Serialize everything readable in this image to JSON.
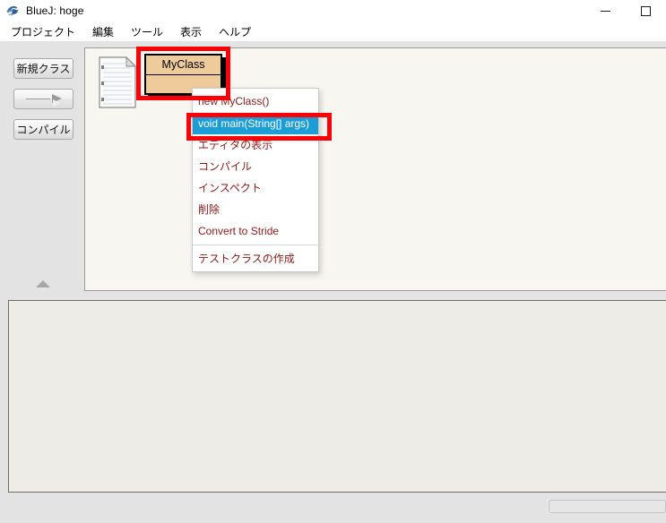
{
  "window": {
    "title": "BlueJ:  hoge",
    "app_icon": "bluej-bird-icon",
    "controls": [
      {
        "name": "minimize-button",
        "glyph": "minimize-icon"
      },
      {
        "name": "maximize-button",
        "glyph": "maximize-icon"
      }
    ]
  },
  "menubar": {
    "items": [
      {
        "label": "プロジェクト",
        "name": "menu-project"
      },
      {
        "label": "編集",
        "name": "menu-edit"
      },
      {
        "label": "ツール",
        "name": "menu-tools"
      },
      {
        "label": "表示",
        "name": "menu-view"
      },
      {
        "label": "ヘルプ",
        "name": "menu-help"
      }
    ]
  },
  "sidebar": {
    "new_class_label": "新規クラス",
    "arrow_label": "",
    "compile_label": "コンパイル",
    "collapse_icon": "triangle-up-icon"
  },
  "workarea": {
    "doc_icon": "document-icon",
    "class_box": {
      "name": "MyClass",
      "fill_color": "#eecb9b",
      "border_color": "#000000"
    }
  },
  "context_menu": {
    "items": [
      {
        "label": "new MyClass()",
        "name": "ctx-new-myclass",
        "highlighted": false
      },
      {
        "label": "void main(String[] args)",
        "name": "ctx-void-main",
        "highlighted": true
      },
      {
        "label": "エディタの表示",
        "name": "ctx-open-editor",
        "highlighted": false
      },
      {
        "label": "コンパイル",
        "name": "ctx-compile",
        "highlighted": false
      },
      {
        "label": "インスペクト",
        "name": "ctx-inspect",
        "highlighted": false
      },
      {
        "label": "削除",
        "name": "ctx-remove",
        "highlighted": false
      },
      {
        "label": "Convert to Stride",
        "name": "ctx-convert-to-stride",
        "highlighted": false
      },
      {
        "label": "テストクラスの作成",
        "name": "ctx-create-test-class",
        "highlighted": false
      }
    ],
    "highlight_color": "#1c9dd6",
    "text_color": "#8b1a16"
  },
  "annotations": {
    "color": "#fb0007",
    "boxes": [
      {
        "name": "annotation-class-box",
        "target": "MyClass"
      },
      {
        "name": "annotation-menu-item",
        "target": "void main(String[] args)"
      }
    ]
  },
  "bottom_panel": {
    "content": "",
    "background_color": "#edece7"
  }
}
